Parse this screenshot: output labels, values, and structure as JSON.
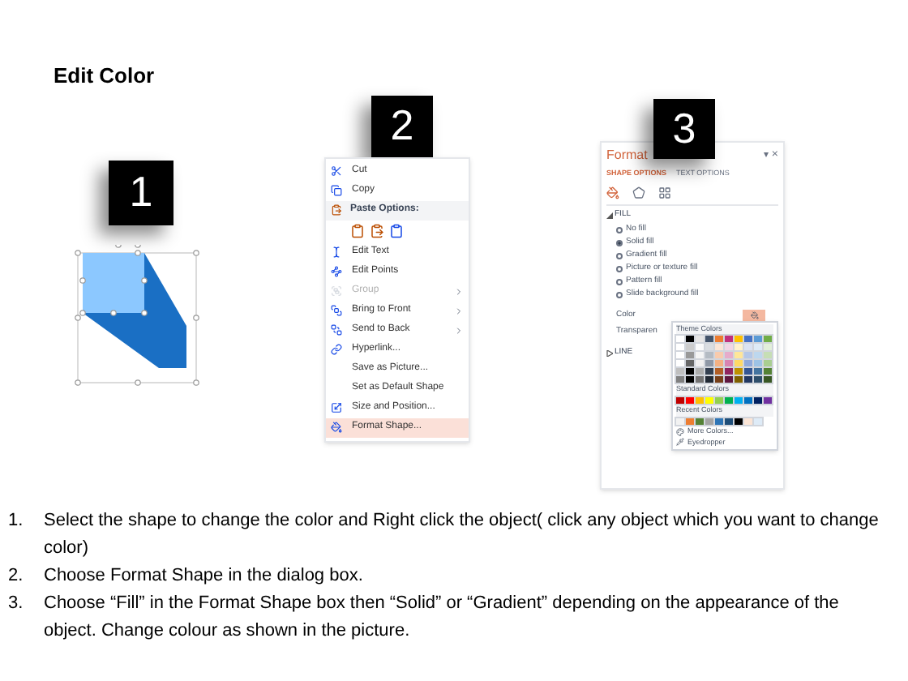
{
  "title": "Edit Color",
  "steps": [
    {
      "badge": "1"
    },
    {
      "badge": "2"
    },
    {
      "badge": "3"
    }
  ],
  "context_menu": [
    {
      "kind": "item",
      "label": "Cut",
      "disabled": false,
      "submenu": false,
      "selected": false
    },
    {
      "kind": "item",
      "label": "Copy",
      "disabled": false,
      "submenu": false,
      "selected": false
    },
    {
      "kind": "header",
      "label": "Paste Options:"
    },
    {
      "kind": "paste-icons"
    },
    {
      "kind": "item",
      "label": "Edit Text",
      "disabled": false,
      "submenu": false,
      "selected": false
    },
    {
      "kind": "item",
      "label": "Edit Points",
      "disabled": false,
      "submenu": false,
      "selected": false
    },
    {
      "kind": "item",
      "label": "Group",
      "disabled": true,
      "submenu": true,
      "selected": false
    },
    {
      "kind": "item",
      "label": "Bring to Front",
      "disabled": false,
      "submenu": true,
      "selected": false
    },
    {
      "kind": "item",
      "label": "Send to Back",
      "disabled": false,
      "submenu": true,
      "selected": false
    },
    {
      "kind": "item",
      "label": "Hyperlink...",
      "disabled": false,
      "submenu": false,
      "selected": false
    },
    {
      "kind": "item",
      "label": "Save as Picture...",
      "disabled": false,
      "submenu": false,
      "selected": false
    },
    {
      "kind": "item",
      "label": "Set as Default Shape",
      "disabled": false,
      "submenu": false,
      "selected": false
    },
    {
      "kind": "item",
      "label": "Size and Position...",
      "disabled": false,
      "submenu": false,
      "selected": false
    },
    {
      "kind": "item",
      "label": "Format Shape...",
      "disabled": false,
      "submenu": false,
      "selected": true
    }
  ],
  "format_panel": {
    "title": "Format",
    "close": "×",
    "dropdown": "▾",
    "tabs": [
      {
        "label": "SHAPE OPTIONS",
        "selected": true
      },
      {
        "label": "TEXT OPTIONS",
        "selected": false
      }
    ],
    "fill_section": {
      "label": "FILL",
      "expanded": true
    },
    "fill_options": [
      {
        "label": "No fill",
        "selected": false
      },
      {
        "label": "Solid fill",
        "selected": true
      },
      {
        "label": "Gradient fill",
        "selected": false
      },
      {
        "label": "Picture or texture fill",
        "selected": false
      },
      {
        "label": "Pattern fill",
        "selected": false
      },
      {
        "label": "Slide background fill",
        "selected": false
      }
    ],
    "color_label": "Color",
    "transparency_label": "Transparen",
    "line_section": {
      "label": "LINE",
      "expanded": false
    },
    "color_picker": {
      "theme_label": "Theme Colors",
      "theme_colors": [
        {
          "color": "#ffffff"
        },
        {
          "color": "#000000"
        },
        {
          "color": "#e7e6e6"
        },
        {
          "color": "#44546a"
        },
        {
          "color": "#ed7d31"
        },
        {
          "color": "#c0307d"
        },
        {
          "color": "#ffc000"
        },
        {
          "color": "#4472c4"
        },
        {
          "color": "#5b9bd5"
        },
        {
          "color": "#70ad47"
        }
      ],
      "standard_label": "Standard Colors",
      "standard_colors": [
        {
          "color": "#c00000"
        },
        {
          "color": "#ff0000"
        },
        {
          "color": "#ffc000"
        },
        {
          "color": "#ffff00"
        },
        {
          "color": "#92d050"
        },
        {
          "color": "#00b050"
        },
        {
          "color": "#00b0f0"
        },
        {
          "color": "#0070c0"
        },
        {
          "color": "#002060"
        },
        {
          "color": "#7030a0"
        }
      ],
      "recent_label": "Recent Colors",
      "recent_colors": [
        {
          "color": "#f2f2f2"
        },
        {
          "color": "#ed7d31"
        },
        {
          "color": "#548235"
        },
        {
          "color": "#a5a5a5"
        },
        {
          "color": "#2e75b6"
        },
        {
          "color": "#1f4e79"
        },
        {
          "color": "#000000"
        },
        {
          "color": "#fbe5d6"
        },
        {
          "color": "#deebf7"
        }
      ],
      "more_colors": "More Colors...",
      "eyedropper": "Eyedropper"
    }
  },
  "instructions": [
    {
      "number": "1.",
      "text": "Select the shape to change the color and Right click the object( click any object which you want to change color)"
    },
    {
      "number": "2.",
      "text": "Choose Format Shape in the dialog box."
    },
    {
      "number": "3.",
      "text": "Choose “Fill” in the Format Shape box then “Solid” or “Gradient” depending on the appearance of the object. Change colour as shown in the picture."
    }
  ]
}
